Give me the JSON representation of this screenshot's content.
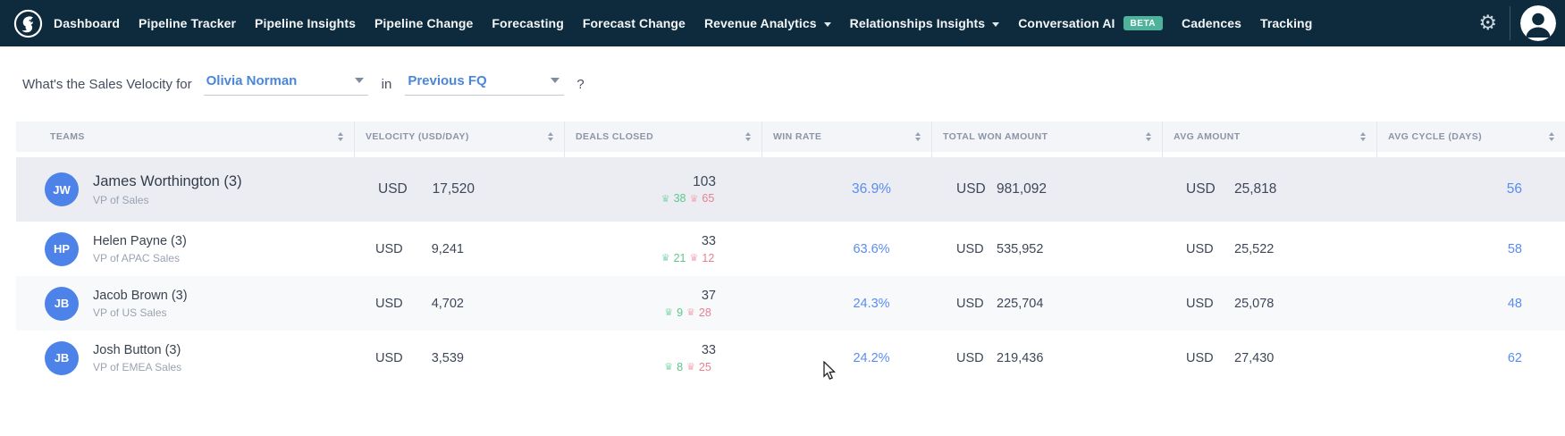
{
  "nav": {
    "items": [
      {
        "label": "Dashboard"
      },
      {
        "label": "Pipeline Tracker"
      },
      {
        "label": "Pipeline Insights"
      },
      {
        "label": "Pipeline Change"
      },
      {
        "label": "Forecasting"
      },
      {
        "label": "Forecast Change"
      },
      {
        "label": "Revenue Analytics",
        "has_chevron": true
      },
      {
        "label": "Relationships Insights",
        "has_chevron": true
      },
      {
        "label": "Conversation AI",
        "badge": "BETA"
      },
      {
        "label": "Cadences"
      },
      {
        "label": "Tracking"
      }
    ],
    "icons": {
      "gear": "⚙",
      "logo": "bird-logo",
      "avatar": "user-avatar"
    }
  },
  "query": {
    "prefix": "What's the Sales Velocity for",
    "person_selected": "Olivia Norman",
    "connector": "in",
    "period_selected": "Previous FQ",
    "suffix": "?"
  },
  "table": {
    "columns": [
      {
        "label": "TEAMS"
      },
      {
        "label": "VELOCITY (USD/DAY)"
      },
      {
        "label": "DEALS CLOSED"
      },
      {
        "label": "WIN RATE"
      },
      {
        "label": "TOTAL WON AMOUNT"
      },
      {
        "label": "AVG AMOUNT"
      },
      {
        "label": "AVG CYCLE (DAYS)"
      }
    ],
    "icons": {
      "won_crown": "♛",
      "lost_crown": "♛"
    },
    "rows": [
      {
        "initials": "JW",
        "name": "James Worthington (3)",
        "role": "VP of Sales",
        "currency": "USD",
        "velocity": "17,520",
        "deals_closed": "103",
        "deals_won": "38",
        "deals_lost": "65",
        "win_rate": "36.9%",
        "total_won": "981,092",
        "avg_amount": "25,818",
        "avg_cycle": "56",
        "highlighted": true
      },
      {
        "initials": "HP",
        "name": "Helen Payne (3)",
        "role": "VP of APAC Sales",
        "currency": "USD",
        "velocity": "9,241",
        "deals_closed": "33",
        "deals_won": "21",
        "deals_lost": "12",
        "win_rate": "63.6%",
        "total_won": "535,952",
        "avg_amount": "25,522",
        "avg_cycle": "58",
        "highlighted": false
      },
      {
        "initials": "JB",
        "name": "Jacob Brown (3)",
        "role": "VP of US Sales",
        "currency": "USD",
        "velocity": "4,702",
        "deals_closed": "37",
        "deals_won": "9",
        "deals_lost": "28",
        "win_rate": "24.3%",
        "total_won": "225,704",
        "avg_amount": "25,078",
        "avg_cycle": "48",
        "highlighted": false
      },
      {
        "initials": "JB",
        "name": "Josh Button (3)",
        "role": "VP of EMEA Sales",
        "currency": "USD",
        "velocity": "3,539",
        "deals_closed": "33",
        "deals_won": "8",
        "deals_lost": "25",
        "win_rate": "24.2%",
        "total_won": "219,436",
        "avg_amount": "27,430",
        "avg_cycle": "62",
        "highlighted": false
      }
    ]
  },
  "colors": {
    "nav_bg": "#0e2b3d",
    "beta_badge": "#4fb39c",
    "dropdown_blue": "#4a87d8",
    "metric_link_blue": "#5b8def",
    "text_dark": "#3d4757",
    "text_gray": "#9aa3b2",
    "header_gray": "#8b95a7",
    "won_green": "#5ec68d",
    "lost_pink": "#e8808f",
    "avatar_blue": "#4d82e8",
    "row_highlight": "#ebedf3"
  }
}
